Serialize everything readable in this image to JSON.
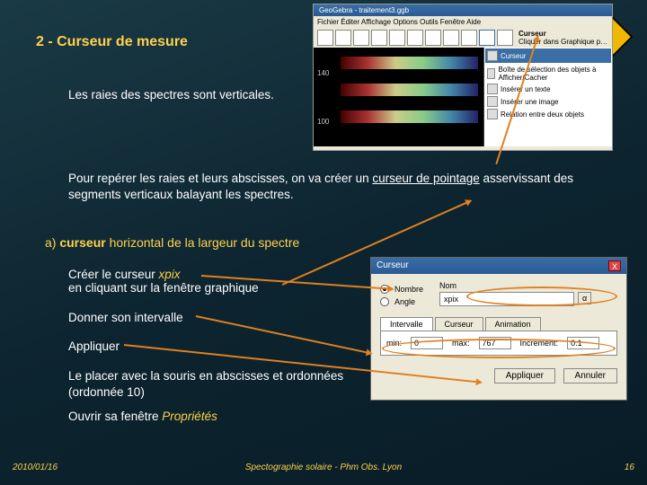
{
  "heading": "2 - Curseur de mesure",
  "para1": "Les raies des spectres sont verticales.",
  "para2_a": "Pour repérer les raies et leurs abscisses, on va créer un ",
  "para2_b": "curseur de pointage",
  "para2_c": " asservissant des segments verticaux balayant les spectres.",
  "sub_a": "a) ",
  "sub_b": "curseur",
  "sub_c": " horizontal de la largeur du spectre",
  "step1_a": "Créer le curseur ",
  "step1_b": "xpix",
  "step1_c": "en cliquant sur la fenêtre graphique",
  "step2": "Donner son intervalle",
  "step3": "Appliquer",
  "step4": "Le placer avec la souris en abscisses et ordonnées  (ordonnée 10)",
  "step5_a": "Ouvrir sa fenêtre ",
  "step5_b": "Propriétés",
  "footer": {
    "date": "2010/01/16",
    "center": "Spectographie solaire -  Phm Obs. Lyon",
    "page": "16"
  },
  "shot1": {
    "title": "GeoGebra - traitement3.ggb",
    "menu": "Fichier  Éditer  Affichage  Options  Outils  Fenêtre  Aide",
    "tool_head1": "Curseur",
    "tool_head2": "Cliquer dans Graphique p…",
    "panel": {
      "curseur": "Curseur",
      "boite": "Boîte de sélection des objets à Afficher/Cacher",
      "texte": "Insérer un texte",
      "image": "Insérer une image",
      "relation": "Relation entre deux objets"
    },
    "axis": {
      "y140": "140",
      "y100": "100"
    }
  },
  "shot2": {
    "title": "Curseur",
    "close": "X",
    "nombre": "Nombre",
    "angle": "Angle",
    "nom_label": "Nom",
    "nom_value": "xpix",
    "alpha": "α",
    "tabs": {
      "intervalle": "Intervalle",
      "curseur": "Curseur",
      "animation": "Animation"
    },
    "min_label": "min:",
    "min_val": "0",
    "max_label": "max:",
    "max_val": "767",
    "incr_label": "Incrément:",
    "incr_val": "0.1",
    "apply": "Appliquer",
    "cancel": "Annuler"
  }
}
